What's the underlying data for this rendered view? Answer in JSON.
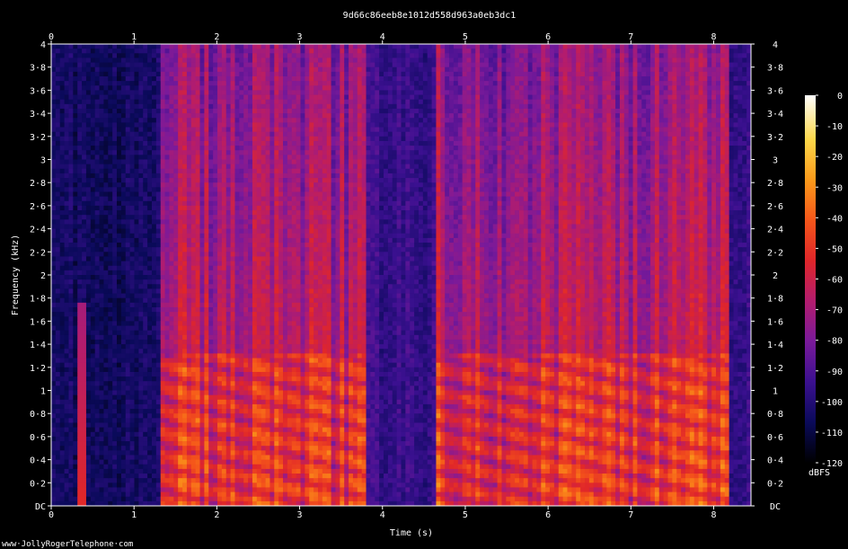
{
  "chart_data": {
    "type": "heatmap",
    "title": "9d66c86eeb8e1012d558d963a0eb3dc1",
    "xlabel": "Time (s)",
    "ylabel": "Frequency (kHz)",
    "xlim": [
      0,
      8.45
    ],
    "ylim": [
      0,
      4
    ],
    "x_ticks": [
      {
        "value": 0,
        "label": "0"
      },
      {
        "value": 1,
        "label": "1"
      },
      {
        "value": 2,
        "label": "2"
      },
      {
        "value": 3,
        "label": "3"
      },
      {
        "value": 4,
        "label": "4"
      },
      {
        "value": 5,
        "label": "5"
      },
      {
        "value": 6,
        "label": "6"
      },
      {
        "value": 7,
        "label": "7"
      },
      {
        "value": 8,
        "label": "8"
      }
    ],
    "y_ticks": [
      {
        "value": 0,
        "label": "DC"
      },
      {
        "value": 0.2,
        "label": "0·2"
      },
      {
        "value": 0.4,
        "label": "0·4"
      },
      {
        "value": 0.6,
        "label": "0·6"
      },
      {
        "value": 0.8,
        "label": "0·8"
      },
      {
        "value": 1.0,
        "label": "1"
      },
      {
        "value": 1.2,
        "label": "1·2"
      },
      {
        "value": 1.4,
        "label": "1·4"
      },
      {
        "value": 1.6,
        "label": "1·6"
      },
      {
        "value": 1.8,
        "label": "1·8"
      },
      {
        "value": 2.0,
        "label": "2"
      },
      {
        "value": 2.2,
        "label": "2·2"
      },
      {
        "value": 2.4,
        "label": "2·4"
      },
      {
        "value": 2.6,
        "label": "2·6"
      },
      {
        "value": 2.8,
        "label": "2·8"
      },
      {
        "value": 3.0,
        "label": "3"
      },
      {
        "value": 3.2,
        "label": "3·2"
      },
      {
        "value": 3.4,
        "label": "3·4"
      },
      {
        "value": 3.6,
        "label": "3·6"
      },
      {
        "value": 3.8,
        "label": "3·8"
      },
      {
        "value": 4.0,
        "label": "4"
      }
    ],
    "colorbar": {
      "label": "dBFS",
      "range": [
        -120,
        0
      ],
      "ticks": [
        {
          "value": 0,
          "label": "0"
        },
        {
          "value": -10,
          "label": "-10"
        },
        {
          "value": -20,
          "label": "-20"
        },
        {
          "value": -30,
          "label": "-30"
        },
        {
          "value": -40,
          "label": "-40"
        },
        {
          "value": -50,
          "label": "-50"
        },
        {
          "value": -60,
          "label": "-60"
        },
        {
          "value": -70,
          "label": "-70"
        },
        {
          "value": -80,
          "label": "-80"
        },
        {
          "value": -90,
          "label": "-90"
        },
        {
          "value": -100,
          "label": "-100"
        },
        {
          "value": -110,
          "label": "-110"
        },
        {
          "value": -120,
          "label": "-120"
        }
      ],
      "colors": [
        "#000000",
        "#0a0a5a",
        "#3b1090",
        "#7a1a9a",
        "#b31c6e",
        "#e0262a",
        "#f5561a",
        "#fb9a1a",
        "#fdd84a",
        "#ffffff"
      ]
    },
    "regions": [
      {
        "t_start": 0.0,
        "t_end": 1.3,
        "level_db": -105,
        "desc": "background noise"
      },
      {
        "t_start": 0.3,
        "t_end": 0.4,
        "level_db": -70,
        "f_max": 1.75,
        "desc": "click"
      },
      {
        "t_start": 1.3,
        "t_end": 3.8,
        "level_db": -60,
        "desc": "speech"
      },
      {
        "t_start": 3.8,
        "t_end": 4.65,
        "level_db": -95,
        "desc": "pause"
      },
      {
        "t_start": 4.65,
        "t_end": 8.2,
        "level_db": -60,
        "desc": "speech"
      },
      {
        "t_start": 8.2,
        "t_end": 8.45,
        "level_db": -95,
        "desc": "tail noise"
      }
    ],
    "grid": false,
    "legend": "colorbar right"
  },
  "footer": {
    "watermark": "www·JollyRogerTelephone·com"
  }
}
